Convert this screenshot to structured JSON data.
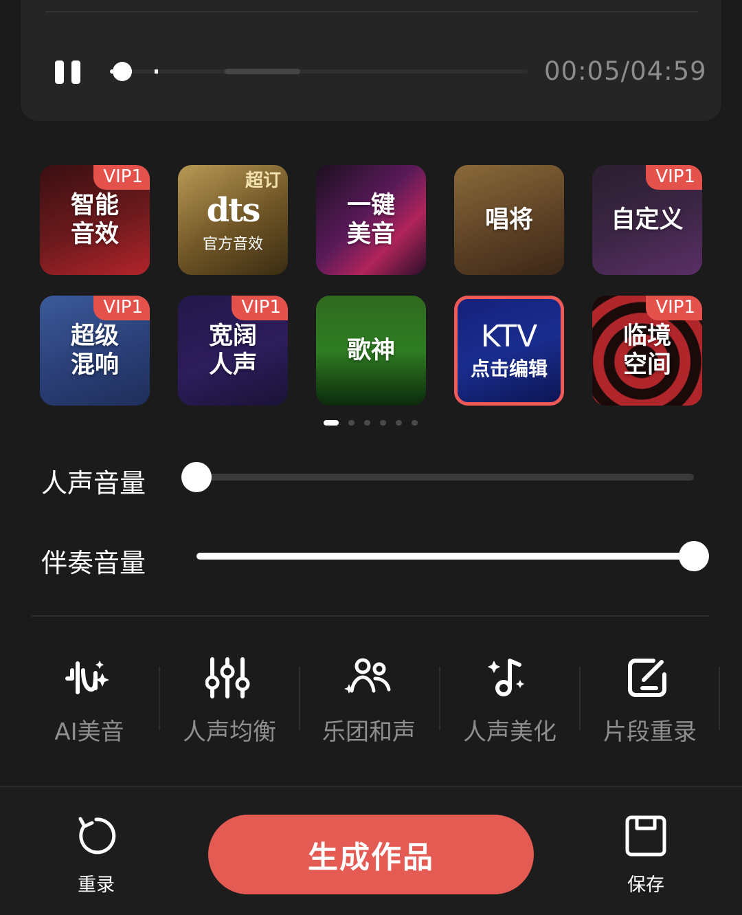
{
  "player": {
    "time": "00:05/04:59",
    "progress_fraction": 0.03
  },
  "effects": [
    {
      "name": "智能\n音效",
      "badge": "VIP1",
      "bg": "linear-gradient(160deg,#3a0f12 0%,#6d1a1d 55%,#b2242b 100%)"
    },
    {
      "name": "官方音效",
      "logo": "dts",
      "badge": "超订",
      "bg": "linear-gradient(150deg,#b89a55 0%,#6f5526 55%,#3a2c12 100%)"
    },
    {
      "name": "一键\n美音",
      "badge": "",
      "bg": "linear-gradient(135deg,#1b0f1f 0%,#5a1a5a 45%,#b0245a 70%,#2a0f2a 100%)"
    },
    {
      "name": "唱将",
      "badge": "",
      "bg": "linear-gradient(160deg,#8a6a3a 0%,#5b3f24 60%,#3b2717 100%)"
    },
    {
      "name": "自定义",
      "badge": "VIP1",
      "bg": "linear-gradient(160deg,#2a1f2f 0%,#3b2544 50%,#5a2f66 100%)"
    },
    {
      "name": "超级\n混响",
      "badge": "VIP1",
      "bg": "linear-gradient(160deg,#3b5a9a 0%,#2b3f78 55%,#1f2e5a 100%)"
    },
    {
      "name": "宽阔\n人声",
      "badge": "VIP1",
      "bg": "linear-gradient(160deg,#23184a 0%,#2d1d5c 55%,#1a1236 100%)"
    },
    {
      "name": "歌神",
      "badge": "",
      "bg": "linear-gradient(180deg,#2f6a1f 0%,#2e7d22 50%,#0c2a0c 100%)"
    },
    {
      "name": "KTV",
      "sub": "点击编辑",
      "badge": "",
      "selected": true,
      "bg": "linear-gradient(160deg,#15207a 0%,#1a2d8f 50%,#0c1450 100%)"
    },
    {
      "name": "临境\n空间",
      "badge": "VIP1",
      "bg": "radial-gradient(circle at 45% 60%,#1a0a0a 0 18%,#b0262a 19% 30%,#1a0a0a 31% 42%,#b0262a 43% 54%,#1a0a0a 55% 66%,#b0262a 67% 78%,#1a0a0a 79%)"
    }
  ],
  "pager": {
    "count": 6,
    "active": 0
  },
  "volume": {
    "vocal_label": "人声音量",
    "vocal_level": 0.0,
    "accompaniment_label": "伴奏音量",
    "accompaniment_level": 1.0
  },
  "tools": [
    {
      "label": "AI美音",
      "icon": "ai-waveform-icon"
    },
    {
      "label": "人声均衡",
      "icon": "equalizer-icon"
    },
    {
      "label": "乐团和声",
      "icon": "group-harmony-icon"
    },
    {
      "label": "人声美化",
      "icon": "music-note-sparkle-icon"
    },
    {
      "label": "片段重录",
      "icon": "edit-square-icon"
    }
  ],
  "bottom": {
    "rerecord_label": "重录",
    "generate_label": "生成作品",
    "save_label": "保存"
  },
  "colors": {
    "accent": "#e45b53",
    "badge": "#e5524c",
    "background": "#1b1b1b"
  }
}
